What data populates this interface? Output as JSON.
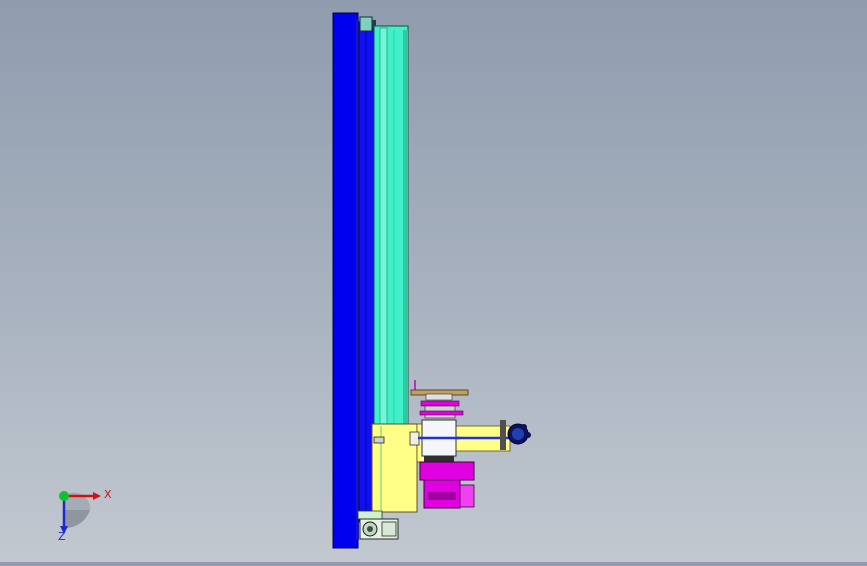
{
  "viewport": {
    "background_top": "#8f9cae",
    "background_bottom": "#c2c8d0"
  },
  "model_colors": {
    "frame": "#0000ee",
    "rail": "#40f0c8",
    "carriage": "#ffff88",
    "motor": "#e000e0",
    "steel": "#e0e4ea"
  },
  "triad": {
    "x_label": "X",
    "z_label": "Z",
    "x_color": "#d41010",
    "z_color": "#1a2ad0",
    "origin_color": "#10c030"
  }
}
